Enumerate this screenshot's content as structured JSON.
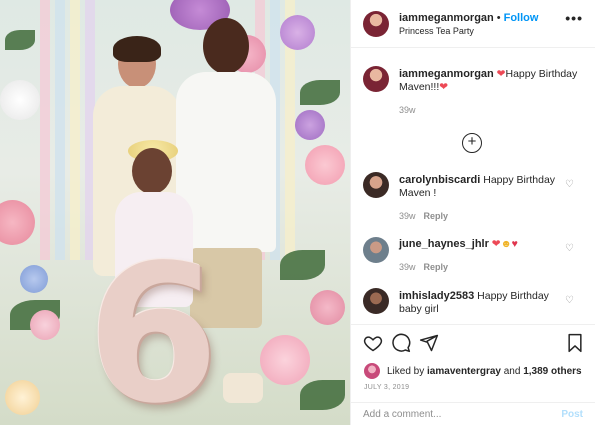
{
  "post": {
    "image_alt": "Family photo at birthday tea party with number 6 balloon",
    "balloon_text": "6"
  },
  "header": {
    "username": "iammeganmorgan",
    "separator": "•",
    "follow_label": "Follow",
    "location": "Princess Tea Party",
    "more_icon": "more-horizontal-icon"
  },
  "caption": {
    "username": "iammeganmorgan",
    "text_before": "Happy Birthday Maven!!!",
    "time": "39w"
  },
  "load_more_icon": "plus-circle-icon",
  "comments": [
    {
      "username": "carolynbiscardi",
      "text": "Happy Birthday Maven !",
      "time": "39w",
      "reply_label": "Reply"
    },
    {
      "username": "june_haynes_jhlr",
      "text": "",
      "time": "39w",
      "reply_label": "Reply"
    },
    {
      "username": "imhislady2583",
      "text": "Happy Birthday baby girl",
      "time": "",
      "reply_label": ""
    }
  ],
  "actions": {
    "like_icon": "heart-icon",
    "comment_icon": "comment-icon",
    "share_icon": "paper-plane-icon",
    "save_icon": "bookmark-icon"
  },
  "likes": {
    "prefix": "Liked by",
    "user": "iamaventergray",
    "and": "and",
    "others": "1,389 others"
  },
  "date": "JULY 3, 2019",
  "add_comment": {
    "placeholder": "Add a comment...",
    "post_label": "Post"
  },
  "colors": {
    "accent": "#0095f6",
    "heart": "#ed4956",
    "muted": "#8e8e8e",
    "post_disabled": "#b2dffc"
  }
}
